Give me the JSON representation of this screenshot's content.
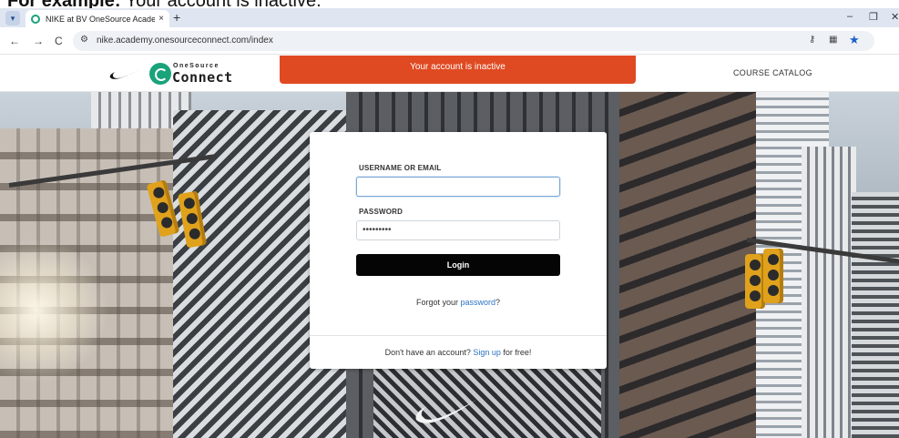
{
  "caption": {
    "bold": "For example:",
    "rest": " Your account is inactive."
  },
  "browser": {
    "tab_title": "NIKE at BV OneSource Academ",
    "tab_close": "×",
    "new_tab": "+",
    "url": "nike.academy.onesourceconnect.com/index",
    "minimize": "–",
    "restore": "❐",
    "close": "✕",
    "back": "←",
    "forward": "→",
    "reload": "C"
  },
  "header": {
    "brand_small": "OneSource",
    "brand_big": "Connect",
    "alert": "Your account is inactive",
    "course_catalog": "COURSE CATALOG"
  },
  "login": {
    "username_label": "USERNAME OR EMAIL",
    "username_value": "",
    "password_label": "PASSWORD",
    "password_value": "•••••••••",
    "login_button": "Login",
    "forgot_prefix": "Forgot your ",
    "forgot_link": "password",
    "forgot_suffix": "?",
    "signup_prefix": "Don't have an account? ",
    "signup_link": "Sign up",
    "signup_suffix": " for free!"
  },
  "colors": {
    "alert": "#e04a22",
    "link": "#2b73c4",
    "login_button": "#050505",
    "brand_green": "#1aa37a"
  }
}
